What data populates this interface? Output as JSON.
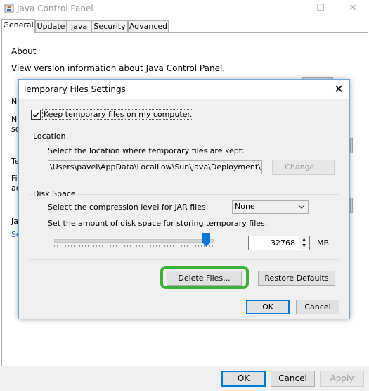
{
  "window": {
    "title": "Java Control Panel",
    "controls": [
      "—",
      "☐",
      "✕"
    ]
  },
  "tabs": [
    "General",
    "Update",
    "Java",
    "Security",
    "Advanced"
  ],
  "general": {
    "about_heading": "About",
    "about_text": "View version information about Java Control Panel.",
    "obscured_fragments": [
      "Ne",
      "Ne",
      "se",
      "Te",
      "Fil",
      "ac",
      "Ja",
      "Se"
    ]
  },
  "bottom_buttons": {
    "ok": "OK",
    "cancel": "Cancel",
    "apply": "Apply"
  },
  "dialog": {
    "title": "Temporary Files Settings",
    "close_glyph": "✕",
    "keep_checkbox": {
      "label": "Keep temporary files on my computer.",
      "checked": true
    },
    "location": {
      "title": "Location",
      "description": "Select the location where temporary files are kept:",
      "path": "\\Users\\pavel\\AppData\\LocalLow\\Sun\\Java\\Deployment\\cache",
      "change_button": "Change..."
    },
    "disk_space": {
      "title": "Disk Space",
      "compression_label": "Select the compression level for JAR files:",
      "compression_value": "None",
      "amount_label": "Set the amount of disk space for storing temporary files:",
      "amount_value": "32768",
      "unit": "MB",
      "slider_fraction": 0.96
    },
    "delete_button": "Delete Files...",
    "restore_button": "Restore Defaults",
    "ok_button": "OK",
    "cancel_button": "Cancel"
  },
  "colors": {
    "highlight": "#3cb135",
    "accent": "#0078d7",
    "link": "#1a5fb4"
  }
}
